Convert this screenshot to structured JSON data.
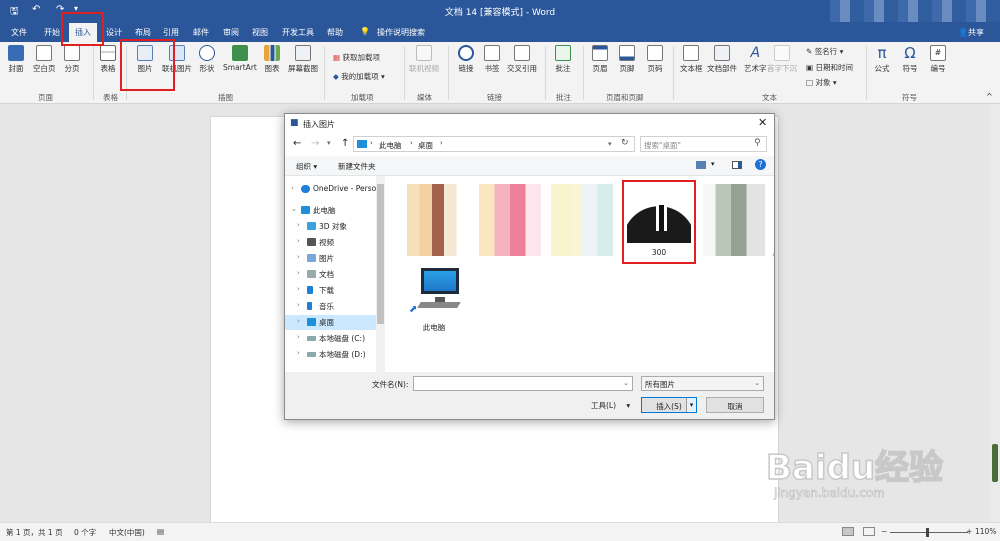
{
  "window": {
    "title": "文档 14 [兼容模式] - Word"
  },
  "tabs": {
    "file": "文件",
    "start": "开始",
    "insert": "插入",
    "design": "设计",
    "layout": "布局",
    "references": "引用",
    "mail": "邮件",
    "review": "审阅",
    "view": "视图",
    "dev": "开发工具",
    "help": "帮助",
    "tellme": "操作说明搜索",
    "share": "共享"
  },
  "ribbon": {
    "pages": {
      "cover": "封面",
      "blank": "空白页",
      "break": "分页",
      "group": "页面"
    },
    "table": {
      "table": "表格",
      "group": "表格"
    },
    "illustrations": {
      "picture": "图片",
      "online": "联机图片",
      "shapes": "形状",
      "smartart": "SmartArt",
      "chart": "图表",
      "screenshot": "屏幕截图",
      "group": "插图"
    },
    "addins": {
      "get": "获取加载项",
      "my": "我的加载项",
      "group": "加载项"
    },
    "media": {
      "video": "联机视频",
      "group": "媒体"
    },
    "links": {
      "link": "链接",
      "bookmark": "书签",
      "crossref": "交叉引用",
      "group": "链接"
    },
    "comments": {
      "comment": "批注",
      "group": "批注"
    },
    "header_footer": {
      "header": "页眉",
      "footer": "页脚",
      "page_number": "页码",
      "group": "页眉和页脚"
    },
    "text": {
      "textbox": "文本框",
      "quickparts": "文档部件",
      "wordart": "艺术字",
      "dropcap": "首字下沉",
      "signature": "签名行",
      "datetime": "日期和时间",
      "object": "对象",
      "group": "文本"
    },
    "symbols": {
      "equation": "公式",
      "symbol": "符号",
      "number": "编号",
      "group": "符号"
    }
  },
  "dialog": {
    "title": "插入图片",
    "breadcrumb": [
      "此电脑",
      "桌面"
    ],
    "search_placeholder": "搜索\"桌面\"",
    "organize": "组织 ▾",
    "new_folder": "新建文件夹",
    "tree": [
      "OneDrive - Perso",
      "此电脑",
      "3D 对象",
      "视频",
      "图片",
      "文档",
      "下载",
      "音乐",
      "桌面",
      "本地磁盘 (C:)",
      "本地磁盘 (D:)"
    ],
    "files": [
      "300",
      "此电脑"
    ],
    "filename_label": "文件名(N):",
    "filename_value": "",
    "filter": "所有图片",
    "tools": "工具(L)",
    "insert": "插入(S)",
    "cancel": "取消"
  },
  "status": {
    "page": "第 1 页，共 1 页",
    "words": "0 个字",
    "lang": "中文(中国)",
    "zoom": "110%"
  },
  "watermark": {
    "brand": "Baidu经验",
    "url": "jingyan.baidu.com"
  },
  "colors": {
    "accent": "#2b579a",
    "highlight": "#e02020"
  }
}
